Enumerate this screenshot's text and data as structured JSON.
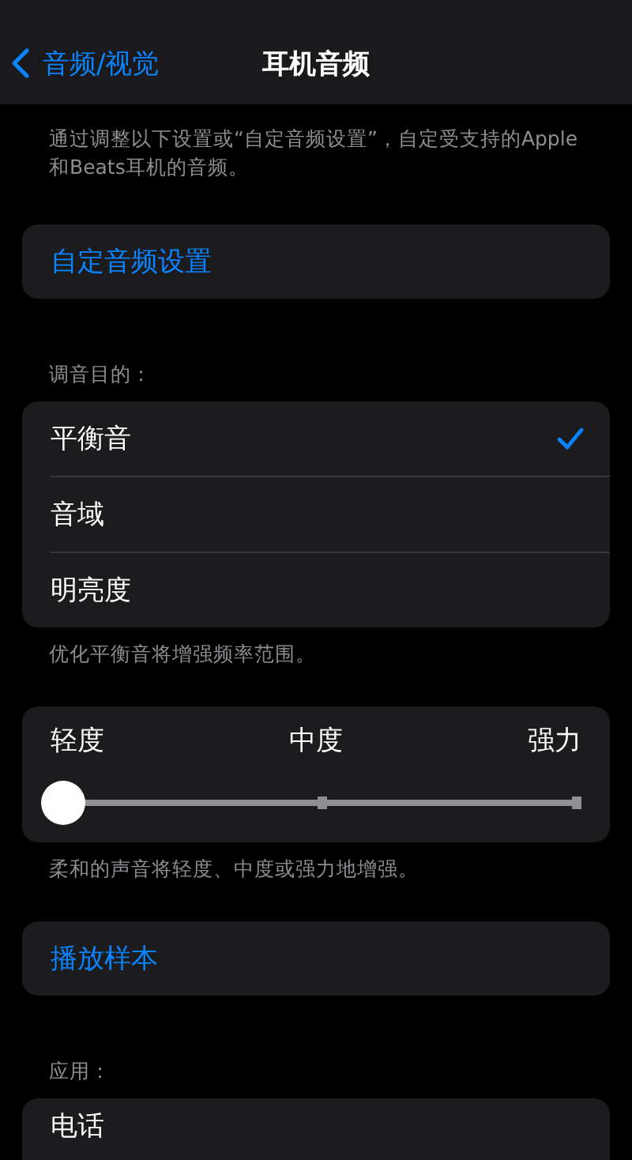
{
  "nav": {
    "back_label": "音频/视觉",
    "title": "耳机音频"
  },
  "intro": "通过调整以下设置或“自定音频设置”，自定受支持的Apple和Beats耳机的音频。",
  "custom_button": "自定音频设置",
  "tuning": {
    "header": "调音目的：",
    "options": [
      {
        "label": "平衡音",
        "selected": true
      },
      {
        "label": "音域",
        "selected": false
      },
      {
        "label": "明亮度",
        "selected": false
      }
    ],
    "footer": "优化平衡音将增强频率范围。"
  },
  "strength": {
    "stops": [
      "轻度",
      "中度",
      "强力"
    ],
    "level": 0,
    "footer": "柔和的声音将轻度、中度或强力地增强。"
  },
  "sample_button": "播放样本",
  "apps": {
    "header": "应用：",
    "items": [
      "电话"
    ]
  }
}
